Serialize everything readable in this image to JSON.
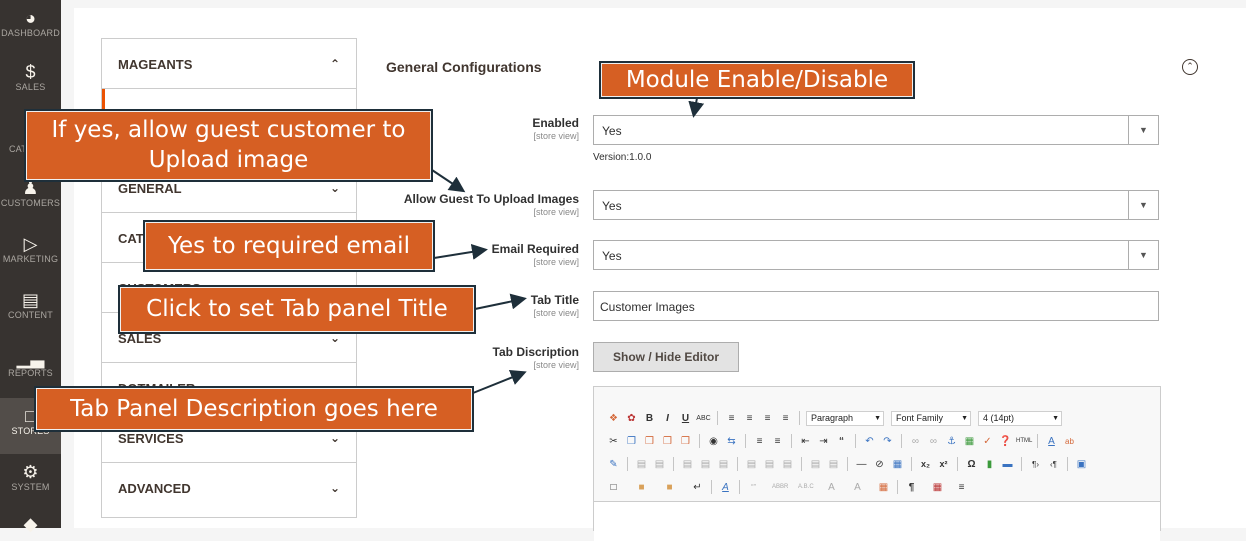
{
  "nav": {
    "items": [
      {
        "label": "DASHBOARD",
        "icon": "dashboard-icon"
      },
      {
        "label": "SALES",
        "icon": "dollar-icon"
      },
      {
        "label": "CATALOG",
        "icon": "cube-icon"
      },
      {
        "label": "CUSTOMERS",
        "icon": "person-icon"
      },
      {
        "label": "MARKETING",
        "icon": "megaphone-icon"
      },
      {
        "label": "CONTENT",
        "icon": "layout-icon"
      },
      {
        "label": "REPORTS",
        "icon": "bar-chart-icon"
      },
      {
        "label": "STORES",
        "icon": "store-icon"
      },
      {
        "label": "SYSTEM",
        "icon": "gear-icon"
      }
    ]
  },
  "sidebar": {
    "sections": [
      {
        "label": "MAGEANTS",
        "chevron": "^"
      },
      {
        "label": "GENERAL",
        "chevron": "v"
      },
      {
        "label": "CATALOG",
        "chevron": "v"
      },
      {
        "label": "CUSTOMERS",
        "chevron": "v"
      },
      {
        "label": "SALES",
        "chevron": "v"
      },
      {
        "label": "DOTMAILER",
        "chevron": "v"
      },
      {
        "label": "SERVICES",
        "chevron": "v"
      },
      {
        "label": "ADVANCED",
        "chevron": "v"
      }
    ]
  },
  "form": {
    "section_title": "General Configurations",
    "scope": "[store view]",
    "fields": {
      "enabled": {
        "label": "Enabled",
        "value": "Yes"
      },
      "guest_upload": {
        "label": "Allow Guest To Upload Images",
        "value": "Yes"
      },
      "email_required": {
        "label": "Email Required",
        "value": "Yes"
      },
      "tab_title": {
        "label": "Tab Title",
        "value": "Customer Images"
      },
      "tab_description": {
        "label": "Tab Discription"
      }
    },
    "version": "Version:1.0.0",
    "editor_button": "Show / Hide Editor"
  },
  "editor": {
    "paragraph": "Paragraph",
    "font_family": "Font Family",
    "font_size": "4 (14pt)"
  },
  "annotations": {
    "module": "Module Enable/Disable",
    "guest": "If yes, allow guest customer to Upload image",
    "email": "Yes to required email",
    "tab_title": "Click to set Tab panel Title",
    "tab_desc": "Tab Panel Description goes here"
  },
  "colors": {
    "annotation_fill": "#d65f23",
    "annotation_border": "#1e2f3a",
    "nav_bg": "#373330",
    "accent": "#eb5202"
  }
}
